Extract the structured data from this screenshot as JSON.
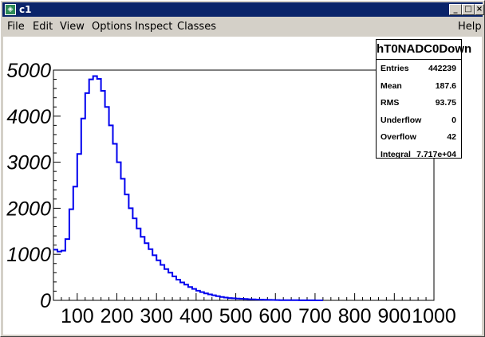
{
  "window": {
    "title": "c1",
    "buttons": {
      "minimize": "_",
      "maximize": "□",
      "close": "×"
    }
  },
  "menu": {
    "items": [
      "File",
      "Edit",
      "View",
      "Options",
      "Inspect",
      "Classes"
    ],
    "help": "Help"
  },
  "stats": {
    "title": "hT0NADC0Down",
    "rows": [
      {
        "name": "Entries",
        "value": "442239"
      },
      {
        "name": "Mean",
        "value": "187.6"
      },
      {
        "name": "RMS",
        "value": "93.75"
      },
      {
        "name": "Underflow",
        "value": "0"
      },
      {
        "name": "Overflow",
        "value": "42"
      },
      {
        "name": "Integral",
        "value": "7.717e+04"
      }
    ]
  },
  "chart_data": {
    "type": "histogram",
    "color": "#0000ee",
    "xlim": [
      40,
      1000
    ],
    "ylim": [
      0,
      5000
    ],
    "x_ticks": [
      100,
      200,
      300,
      400,
      500,
      600,
      700,
      800,
      900,
      1000
    ],
    "y_ticks": [
      0,
      1000,
      2000,
      3000,
      4000,
      5000
    ],
    "bin_width": 10,
    "bins_start": 40,
    "values": [
      1100,
      1060,
      1080,
      1330,
      1980,
      2470,
      3180,
      3950,
      4500,
      4800,
      4870,
      4810,
      4550,
      4200,
      3800,
      3400,
      3000,
      2640,
      2300,
      2000,
      1780,
      1560,
      1380,
      1240,
      1110,
      980,
      870,
      770,
      680,
      600,
      520,
      450,
      390,
      340,
      290,
      250,
      210,
      180,
      150,
      130,
      110,
      90,
      75,
      60,
      50,
      45,
      40,
      35,
      30,
      25,
      22,
      18,
      15,
      13,
      10,
      8,
      7,
      6,
      5,
      4,
      3,
      3,
      2,
      2,
      1,
      1,
      0,
      0
    ]
  }
}
